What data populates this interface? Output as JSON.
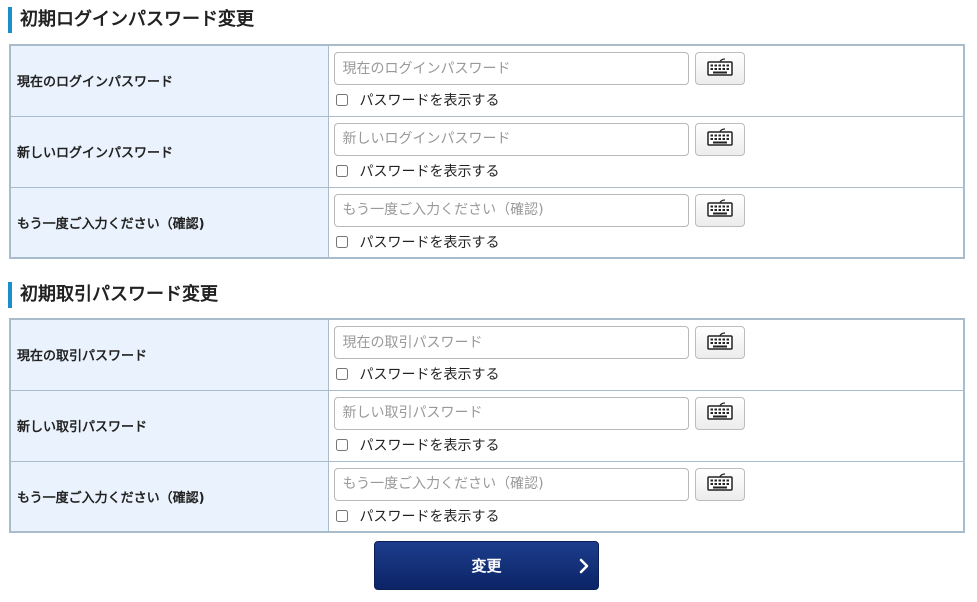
{
  "login_section": {
    "title": "初期ログインパスワード変更",
    "rows": [
      {
        "label": "現在のログインパスワード",
        "placeholder": "現在のログインパスワード",
        "show_label": "パスワードを表示する"
      },
      {
        "label": "新しいログインパスワード",
        "placeholder": "新しいログインパスワード",
        "show_label": "パスワードを表示する"
      },
      {
        "label": "もう一度ご入力ください（確認)",
        "placeholder": "もう一度ご入力ください（確認)",
        "show_label": "パスワードを表示する"
      }
    ]
  },
  "trade_section": {
    "title": "初期取引パスワード変更",
    "rows": [
      {
        "label": "現在の取引パスワード",
        "placeholder": "現在の取引パスワード",
        "show_label": "パスワードを表示する"
      },
      {
        "label": "新しい取引パスワード",
        "placeholder": "新しい取引パスワード",
        "show_label": "パスワードを表示する"
      },
      {
        "label": "もう一度ご入力ください（確認)",
        "placeholder": "もう一度ご入力ください（確認)",
        "show_label": "パスワードを表示する"
      }
    ]
  },
  "submit": {
    "label": "変更"
  },
  "icons": {
    "keyboard": "keyboard-icon",
    "submit_arrow": "chevron-right-icon"
  },
  "colors": {
    "accent": "#1a8fc9",
    "label_bg": "#eaf3fd",
    "border": "#a8bccb",
    "button": "#0b2466"
  }
}
